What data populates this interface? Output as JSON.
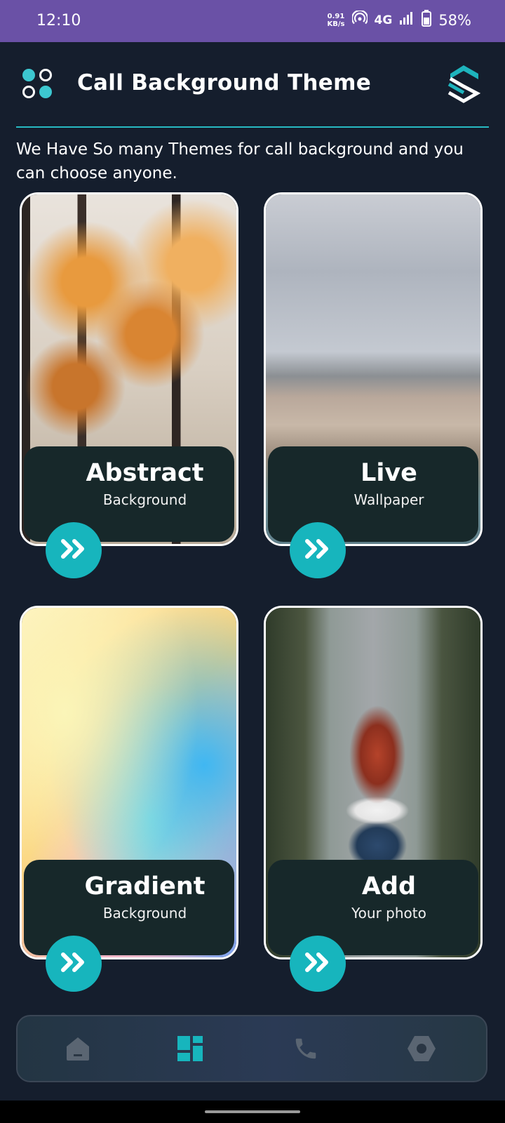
{
  "status_bar": {
    "time": "12:10",
    "net_speed_value": "0.91",
    "net_speed_unit": "KB/s",
    "network": "4G",
    "battery": "58%"
  },
  "header": {
    "title": "Call Background Theme",
    "subtitle": "We Have So many Themes for call background and you can choose anyone."
  },
  "cards": [
    {
      "title": "Abstract",
      "subtitle": "Background",
      "image": "autumn-trees"
    },
    {
      "title": "Live",
      "subtitle": "Wallpaper",
      "image": "city-skyline"
    },
    {
      "title": "Gradient",
      "subtitle": "Background",
      "image": "pastel-gradient"
    },
    {
      "title": "Add",
      "subtitle": "Your photo",
      "image": "woman-on-road"
    }
  ],
  "bottom_nav": [
    {
      "icon": "home-icon",
      "active": false
    },
    {
      "icon": "dashboard-icon",
      "active": true
    },
    {
      "icon": "phone-icon",
      "active": false
    },
    {
      "icon": "settings-icon",
      "active": false
    }
  ],
  "colors": {
    "background": "#151e2d",
    "status_bar": "#6a51a6",
    "accent": "#17b5bd",
    "panel": "#17282a",
    "nav_inactive": "#5a6572"
  }
}
